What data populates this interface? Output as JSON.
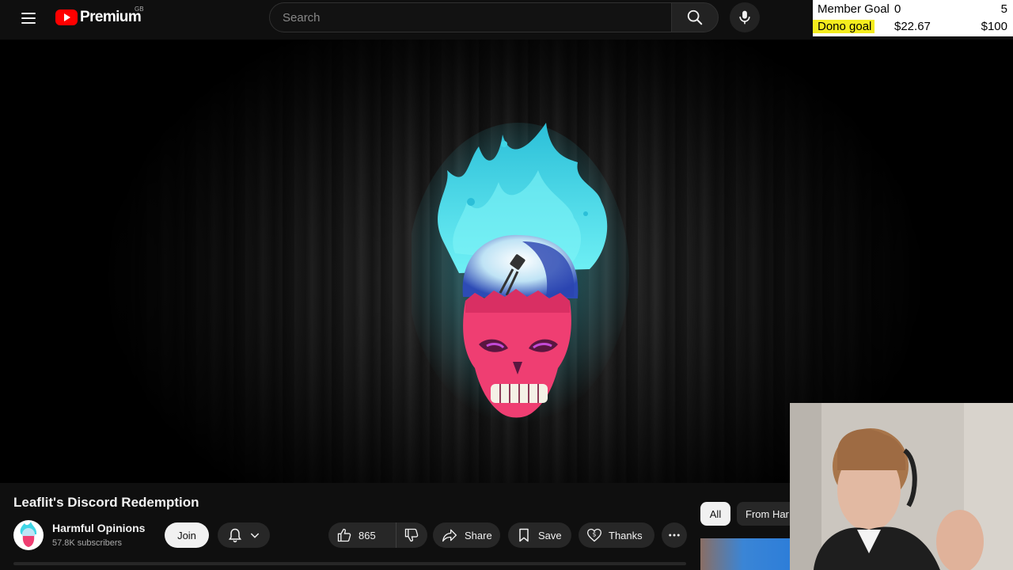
{
  "topbar": {
    "logo_text": "Premium",
    "region": "GB",
    "search_placeholder": "Search",
    "icons": {
      "menu": "menu-icon",
      "search": "search-icon",
      "mic": "mic-icon"
    }
  },
  "overlay_goals": {
    "member": {
      "label": "Member Goal",
      "current": "0",
      "target": "5"
    },
    "dono": {
      "label": "Dono goal",
      "current": "$22.67",
      "target": "$100"
    },
    "highlight_color": "#f4ec1e"
  },
  "video": {
    "title": "Leaflit's Discord Redemption"
  },
  "channel": {
    "name": "Harmful Opinions",
    "subscribers": "57.8K subscribers",
    "join_label": "Join"
  },
  "actions": {
    "likes": "865",
    "share_label": "Share",
    "save_label": "Save",
    "thanks_label": "Thanks"
  },
  "chips": {
    "all": "All",
    "from": "From Har"
  },
  "colors": {
    "brand_red": "#ff0000",
    "background": "#0f0f0f",
    "pill_bg": "#272727",
    "flame_cyan": "#3fd6e6",
    "skull_pink": "#ef3e72"
  }
}
